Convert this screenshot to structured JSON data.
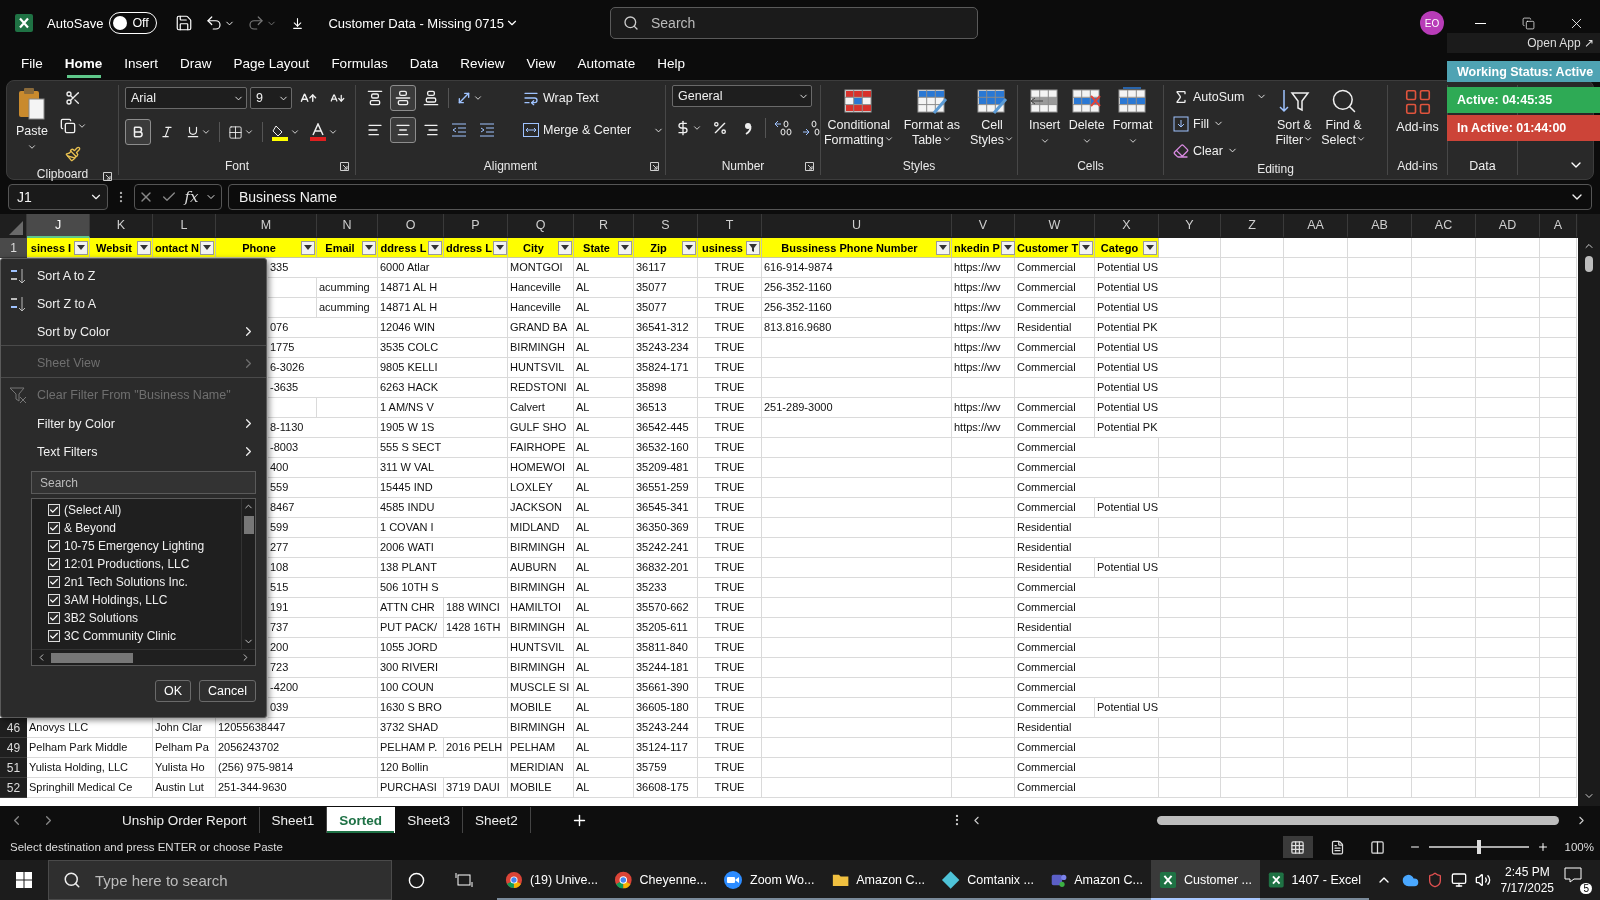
{
  "title_bar": {
    "autosave_label": "AutoSave",
    "autosave": {
      "on": false,
      "label": "Off"
    },
    "document_title": "Customer Data - Missing 0715",
    "search": {
      "placeholder": "Search"
    },
    "avatar": "EO"
  },
  "menu_tabs": [
    {
      "label": "File",
      "selected": false
    },
    {
      "label": "Home",
      "selected": true
    },
    {
      "label": "Insert",
      "selected": false
    },
    {
      "label": "Draw",
      "selected": false
    },
    {
      "label": "Page Layout",
      "selected": false
    },
    {
      "label": "Formulas",
      "selected": false
    },
    {
      "label": "Data",
      "selected": false
    },
    {
      "label": "Review",
      "selected": false
    },
    {
      "label": "View",
      "selected": false
    },
    {
      "label": "Automate",
      "selected": false
    },
    {
      "label": "Help",
      "selected": false
    }
  ],
  "ribbon": {
    "clipboard": {
      "caption": "Clipboard",
      "paste": "Paste"
    },
    "font": {
      "caption": "Font",
      "family": "Arial",
      "size": "9",
      "bold": true,
      "italic": false,
      "underline": false
    },
    "alignment": {
      "caption": "Alignment",
      "align_middle": true,
      "align_center": true,
      "wrap_text": "Wrap Text",
      "merge": "Merge & Center"
    },
    "number": {
      "caption": "Number",
      "format": "General"
    },
    "styles": {
      "caption": "Styles",
      "buttons": [
        [
          "Conditional",
          "Formatting"
        ],
        [
          "Format as",
          "Table"
        ],
        [
          "Cell",
          "Styles"
        ]
      ]
    },
    "cells": {
      "caption": "Cells",
      "buttons": [
        "Insert",
        "Delete",
        "Format"
      ]
    },
    "editing": {
      "caption": "Editing",
      "autosum": "AutoSum",
      "fill": "Fill",
      "clear": "Clear",
      "sort_filter": [
        "Sort &",
        "Filter"
      ],
      "find_select": [
        "Find &",
        "Select"
      ]
    },
    "addins": {
      "caption": "Add-ins",
      "button": "Add-ins"
    },
    "analyze": {
      "label": "Data"
    }
  },
  "status_widget": {
    "open_app": "Open App ↗",
    "items": [
      {
        "label": "Working Status: Active",
        "color": "#4fa3b3"
      },
      {
        "label": "Active: 04:45:35",
        "color": "#2eaa55"
      },
      {
        "label": "In Active: 01:44:00",
        "color": "#cc4438"
      }
    ]
  },
  "formula_bar": {
    "name_box": "J1",
    "function_label": "fx",
    "value": "Business Name"
  },
  "columns": [
    {
      "letter": "J",
      "selected": true
    },
    {
      "letter": "K",
      "selected": false
    },
    {
      "letter": "L",
      "selected": false
    },
    {
      "letter": "M",
      "selected": false
    },
    {
      "letter": "N",
      "selected": false
    },
    {
      "letter": "O",
      "selected": false
    },
    {
      "letter": "P",
      "selected": false
    },
    {
      "letter": "Q",
      "selected": false
    },
    {
      "letter": "R",
      "selected": false
    },
    {
      "letter": "S",
      "selected": false
    },
    {
      "letter": "T",
      "selected": false
    },
    {
      "letter": "U",
      "selected": false
    },
    {
      "letter": "V",
      "selected": false
    },
    {
      "letter": "W",
      "selected": false
    },
    {
      "letter": "X",
      "selected": false
    },
    {
      "letter": "Y",
      "selected": false
    },
    {
      "letter": "Z",
      "selected": false
    },
    {
      "letter": "AA",
      "selected": false
    },
    {
      "letter": "AB",
      "selected": false
    },
    {
      "letter": "AC",
      "selected": false
    },
    {
      "letter": "AD",
      "selected": false
    },
    {
      "letter": "A",
      "selected": false
    }
  ],
  "header_row": {
    "number": "1",
    "selected": true,
    "cells": [
      {
        "text": "siness I",
        "filtered": false
      },
      {
        "text": "Websit",
        "filtered": false
      },
      {
        "text": "ontact N",
        "filtered": false
      },
      {
        "text": "Phone",
        "filtered": false
      },
      {
        "text": "Email",
        "filtered": false
      },
      {
        "text": "ddress L",
        "filtered": false
      },
      {
        "text": "ddress L",
        "filtered": false
      },
      {
        "text": "City",
        "filtered": false
      },
      {
        "text": "State",
        "filtered": false
      },
      {
        "text": "Zip",
        "filtered": false
      },
      {
        "text": "usiness",
        "filtered": true
      },
      {
        "text": "Bussiness Phone Number",
        "filtered": false
      },
      {
        "text": "nkedin P",
        "filtered": false
      },
      {
        "text": "Customer T",
        "filtered": false
      },
      {
        "text": "Catego",
        "filtered": false
      }
    ]
  },
  "rows": [
    {
      "covered": true,
      "cells": [
        "335",
        null,
        "6000 Atlar",
        null,
        "MONTGOI",
        "AL",
        "36117",
        "TRUE",
        "616-914-9874",
        "https://wv",
        "Commercial",
        "Potential US"
      ]
    },
    {
      "covered": true,
      "cells": [
        null,
        "acumming",
        "14871 AL H",
        null,
        "Hanceville",
        "AL",
        "35077",
        "TRUE",
        "256-352-1160",
        "https://wv",
        "Commercial",
        "Potential US"
      ]
    },
    {
      "covered": true,
      "cells": [
        null,
        "acumming",
        "14871 AL H",
        null,
        "Hanceville",
        "AL",
        "35077",
        "TRUE",
        "256-352-1160",
        "https://wv",
        "Commercial",
        "Potential US"
      ]
    },
    {
      "covered": true,
      "cells": [
        "076",
        null,
        "12046 WIN",
        null,
        "GRAND BA",
        "AL",
        "36541-312",
        "TRUE",
        "813.816.9680",
        "https://wv",
        "Residential",
        "Potential PK"
      ]
    },
    {
      "covered": true,
      "cells": [
        "1775",
        null,
        "3535 COLC",
        null,
        "BIRMINGH",
        "AL",
        "35243-234",
        "TRUE",
        null,
        "https://wv",
        "Commercial",
        "Potential US"
      ]
    },
    {
      "covered": true,
      "cells": [
        "6-3026",
        null,
        "9805 KELLI",
        null,
        "HUNTSVIL",
        "AL",
        "35824-171",
        "TRUE",
        null,
        "https://wv",
        "Commercial",
        "Potential US"
      ]
    },
    {
      "covered": true,
      "cells": [
        "-3635",
        null,
        "6263 HACK",
        null,
        "REDSTONI",
        "AL",
        "35898",
        "TRUE",
        null,
        null,
        null,
        "Potential US"
      ]
    },
    {
      "covered": true,
      "cells": [
        null,
        null,
        "1 AM/NS V",
        null,
        "Calvert",
        "AL",
        "36513",
        "TRUE",
        "251-289-3000",
        "https://wv",
        "Commercial",
        "Potential US"
      ]
    },
    {
      "covered": true,
      "cells": [
        "8-1130",
        null,
        "1905 W 1S",
        null,
        "GULF SHO",
        "AL",
        "36542-445",
        "TRUE",
        null,
        "https://wv",
        "Commercial",
        "Potential PK"
      ]
    },
    {
      "covered": true,
      "cells": [
        "-8003",
        null,
        "555 S SECT",
        null,
        "FAIRHOPE",
        "AL",
        "36532-160",
        "TRUE",
        null,
        null,
        "Commercial"
      ]
    },
    {
      "covered": true,
      "cells": [
        "400",
        null,
        "311 W VAL",
        null,
        "HOMEWOI",
        "AL",
        "35209-481",
        "TRUE",
        null,
        null,
        "Commercial"
      ]
    },
    {
      "covered": true,
      "cells": [
        "559",
        null,
        "15445 IND",
        null,
        "LOXLEY",
        "AL",
        "36551-259",
        "TRUE",
        null,
        null,
        "Commercial"
      ]
    },
    {
      "covered": true,
      "cells": [
        "8467",
        null,
        "4585 INDU",
        null,
        "JACKSON",
        "AL",
        "36545-341",
        "TRUE",
        null,
        null,
        "Commercial",
        "Potential US"
      ]
    },
    {
      "covered": true,
      "cells": [
        "599",
        null,
        "1 COVAN I",
        null,
        "MIDLAND",
        "AL",
        "36350-369",
        "TRUE",
        null,
        null,
        "Residential"
      ]
    },
    {
      "covered": true,
      "cells": [
        "277",
        null,
        "2006 WATI",
        null,
        "BIRMINGH",
        "AL",
        "35242-241",
        "TRUE",
        null,
        null,
        "Residential"
      ]
    },
    {
      "covered": true,
      "cells": [
        "108",
        null,
        "138 PLANT",
        null,
        "AUBURN",
        "AL",
        "36832-201",
        "TRUE",
        null,
        null,
        "Residential",
        "Potential US"
      ]
    },
    {
      "covered": true,
      "cells": [
        "515",
        null,
        "506 10TH S",
        null,
        "BIRMINGH",
        "AL",
        "35233",
        "TRUE",
        null,
        null,
        "Commercial"
      ]
    },
    {
      "covered": true,
      "cells": [
        "191",
        null,
        "ATTN CHR",
        "188 WINCI",
        "HAMILTOI",
        "AL",
        "35570-662",
        "TRUE",
        null,
        null,
        "Commercial"
      ]
    },
    {
      "covered": true,
      "cells": [
        "737",
        null,
        "PUT PACK/",
        "1428 16TH",
        "BIRMINGH",
        "AL",
        "35205-611",
        "TRUE",
        null,
        null,
        "Residential"
      ]
    },
    {
      "covered": true,
      "cells": [
        "200",
        null,
        "1055 JORD",
        null,
        "HUNTSVIL",
        "AL",
        "35811-840",
        "TRUE",
        null,
        null,
        "Commercial"
      ]
    },
    {
      "covered": true,
      "cells": [
        "723",
        null,
        "300 RIVERI",
        null,
        "BIRMINGH",
        "AL",
        "35244-181",
        "TRUE",
        null,
        null,
        "Commercial"
      ]
    },
    {
      "covered": true,
      "cells": [
        "-4200",
        null,
        "100 COUN",
        null,
        "MUSCLE SI",
        "AL",
        "35661-390",
        "TRUE",
        null,
        null,
        "Commercial"
      ]
    },
    {
      "covered": true,
      "cells": [
        "039",
        null,
        "1630 S BRO",
        null,
        "MOBILE",
        "AL",
        "36605-180",
        "TRUE",
        null,
        null,
        "Commercial",
        "Potential US"
      ]
    },
    {
      "covered": false,
      "number": "46",
      "cells": [
        "Anovys LLC",
        null,
        "John Clar",
        "12055638447",
        null,
        "3732 SHAD",
        null,
        "BIRMINGH",
        "AL",
        "35243-244",
        "TRUE",
        null,
        null,
        "Residential"
      ]
    },
    {
      "covered": false,
      "number": "49",
      "cells": [
        "Pelham Park Middle",
        null,
        "Pelham Pa",
        "2056243702",
        null,
        "PELHAM P.",
        "2016 PELH",
        "PELHAM",
        "AL",
        "35124-117",
        "TRUE",
        null,
        null,
        "Commercial"
      ]
    },
    {
      "covered": false,
      "number": "51",
      "cells": [
        "Yulista Holding, LLC",
        null,
        "Yulista Ho",
        "(256) 975-9814",
        null,
        "120 Bollin",
        null,
        "MERIDIAN",
        "AL",
        "35759",
        "TRUE",
        null,
        null,
        "Commercial"
      ]
    },
    {
      "covered": false,
      "number": "52",
      "cells": [
        "Springhill Medical Ce",
        null,
        "Austin Lut",
        "251-344-9630",
        null,
        "PURCHASI",
        "3719 DAUI",
        "MOBILE",
        "AL",
        "36608-175",
        "TRUE",
        null,
        null,
        "Commercial"
      ]
    }
  ],
  "filter_menu": {
    "items": [
      {
        "label": "Sort A to Z",
        "kind": "sort_ascending",
        "disabled": false,
        "submenu": false,
        "divider_before": false
      },
      {
        "label": "Sort Z to A",
        "kind": "sort_descending",
        "disabled": false,
        "submenu": false,
        "divider_before": false
      },
      {
        "label": "Sort by Color",
        "kind": "plain",
        "disabled": false,
        "submenu": true,
        "divider_before": false
      },
      {
        "label": "Sheet View",
        "kind": "plain",
        "disabled": true,
        "submenu": true,
        "divider_before": true
      },
      {
        "label": "Clear Filter From \"Business Name\"",
        "kind": "clear_filter",
        "disabled": true,
        "submenu": false,
        "divider_before": true
      },
      {
        "label": "Filter by Color",
        "kind": "plain",
        "disabled": false,
        "submenu": true,
        "divider_before": false
      },
      {
        "label": "Text Filters",
        "kind": "plain",
        "disabled": false,
        "submenu": true,
        "divider_before": false
      }
    ],
    "search": {
      "placeholder": "Search"
    },
    "values": [
      {
        "label": "(Select All)",
        "checked": true
      },
      {
        "label": "& Beyond",
        "checked": true
      },
      {
        "label": "10-75 Emergency Lighting",
        "checked": true
      },
      {
        "label": "12:01 Productions, LLC",
        "checked": true
      },
      {
        "label": "2n1 Tech Solutions Inc.",
        "checked": true
      },
      {
        "label": "3AM Holdings, LLC",
        "checked": true
      },
      {
        "label": "3B2 Solutions",
        "checked": true
      },
      {
        "label": "3C Community Clinic",
        "checked": true
      }
    ],
    "buttons": [
      "OK",
      "Cancel"
    ]
  },
  "sheet_tabs": [
    {
      "label": "Unship Order Report",
      "selected": false
    },
    {
      "label": "Sheet1",
      "selected": false
    },
    {
      "label": "Sorted",
      "selected": true
    },
    {
      "label": "Sheet3",
      "selected": false
    },
    {
      "label": "Sheet2",
      "selected": false
    }
  ],
  "status_bar": {
    "message": "Select destination and press ENTER or choose Paste",
    "zoom": {
      "level": 0.5,
      "label": "100%"
    }
  },
  "taskbar": {
    "search": {
      "placeholder": "Type here to search"
    },
    "apps": [
      {
        "label": "(19) Unive...",
        "kind": "browser",
        "selected": false
      },
      {
        "label": "Cheyenne...",
        "kind": "browser",
        "selected": false
      },
      {
        "label": "Zoom Wo...",
        "kind": "zoom",
        "selected": false
      },
      {
        "label": "Amazon C...",
        "kind": "folder",
        "selected": false
      },
      {
        "label": "Comtanix ...",
        "kind": "diamond",
        "selected": false
      },
      {
        "label": "Amazon C...",
        "kind": "teams",
        "selected": false
      },
      {
        "label": "Customer ...",
        "kind": "excel",
        "selected": true
      },
      {
        "label": "1407 - Excel",
        "kind": "excel",
        "selected": false
      }
    ],
    "clock": {
      "time": "2:45 PM",
      "date": "7/17/2025"
    },
    "notifications": "5"
  }
}
